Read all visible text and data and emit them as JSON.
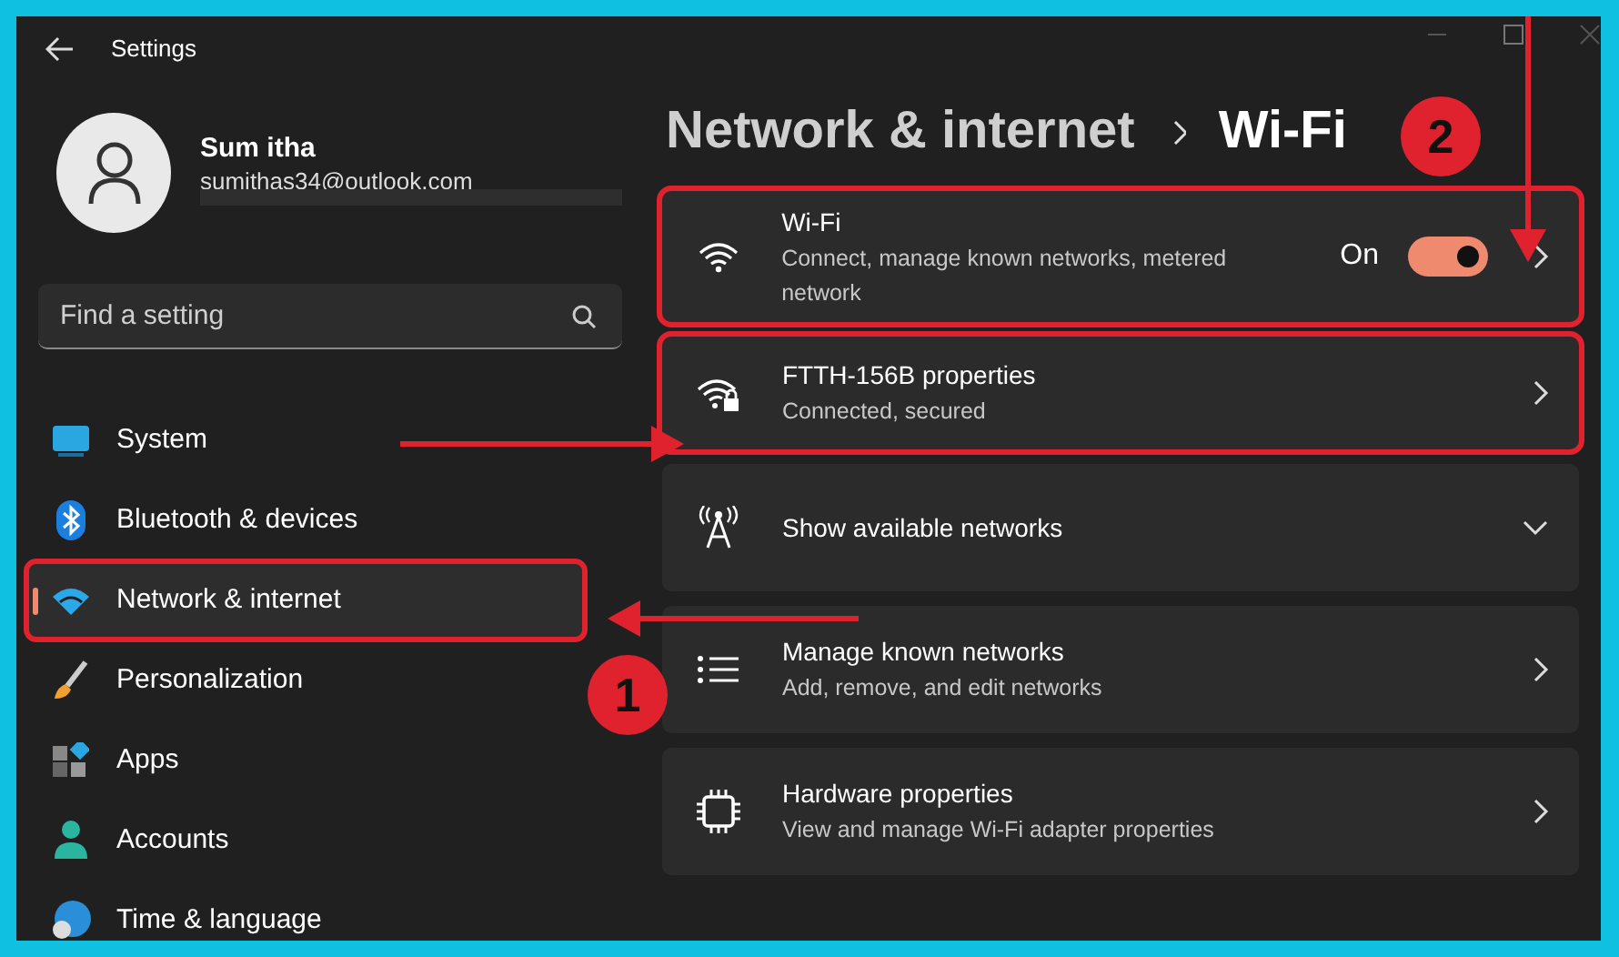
{
  "window": {
    "title": "Settings"
  },
  "user": {
    "name": "Sum itha",
    "email": "sumithas34@outlook.com"
  },
  "search": {
    "placeholder": "Find a setting"
  },
  "sidebar": {
    "items": [
      {
        "label": "System",
        "selected": false,
        "highlighted": false
      },
      {
        "label": "Bluetooth & devices",
        "selected": false,
        "highlighted": false
      },
      {
        "label": "Network & internet",
        "selected": true,
        "highlighted": true
      },
      {
        "label": "Personalization",
        "selected": false,
        "highlighted": false
      },
      {
        "label": "Apps",
        "selected": false,
        "highlighted": false
      },
      {
        "label": "Accounts",
        "selected": false,
        "highlighted": false
      },
      {
        "label": "Time & language",
        "selected": false,
        "highlighted": false
      }
    ]
  },
  "breadcrumb": {
    "parent": "Network & internet",
    "current": "Wi-Fi"
  },
  "cards": [
    {
      "kind": "toggle",
      "title": "Wi-Fi",
      "subtitle": "Connect, manage known networks, metered network",
      "state_label": "On",
      "on": true,
      "highlighted": true
    },
    {
      "kind": "link",
      "title": "FTTH-156B properties",
      "subtitle": "Connected, secured",
      "highlighted": true
    },
    {
      "kind": "expander",
      "title": "Show available networks",
      "expanded": false,
      "highlighted": false
    },
    {
      "kind": "link",
      "title": "Manage known networks",
      "subtitle": "Add, remove, and edit networks",
      "highlighted": false
    },
    {
      "kind": "link",
      "title": "Hardware properties",
      "subtitle": "View and manage Wi-Fi adapter properties",
      "highlighted": false
    }
  ],
  "annotations": [
    {
      "label": "1"
    },
    {
      "label": "2"
    }
  ]
}
